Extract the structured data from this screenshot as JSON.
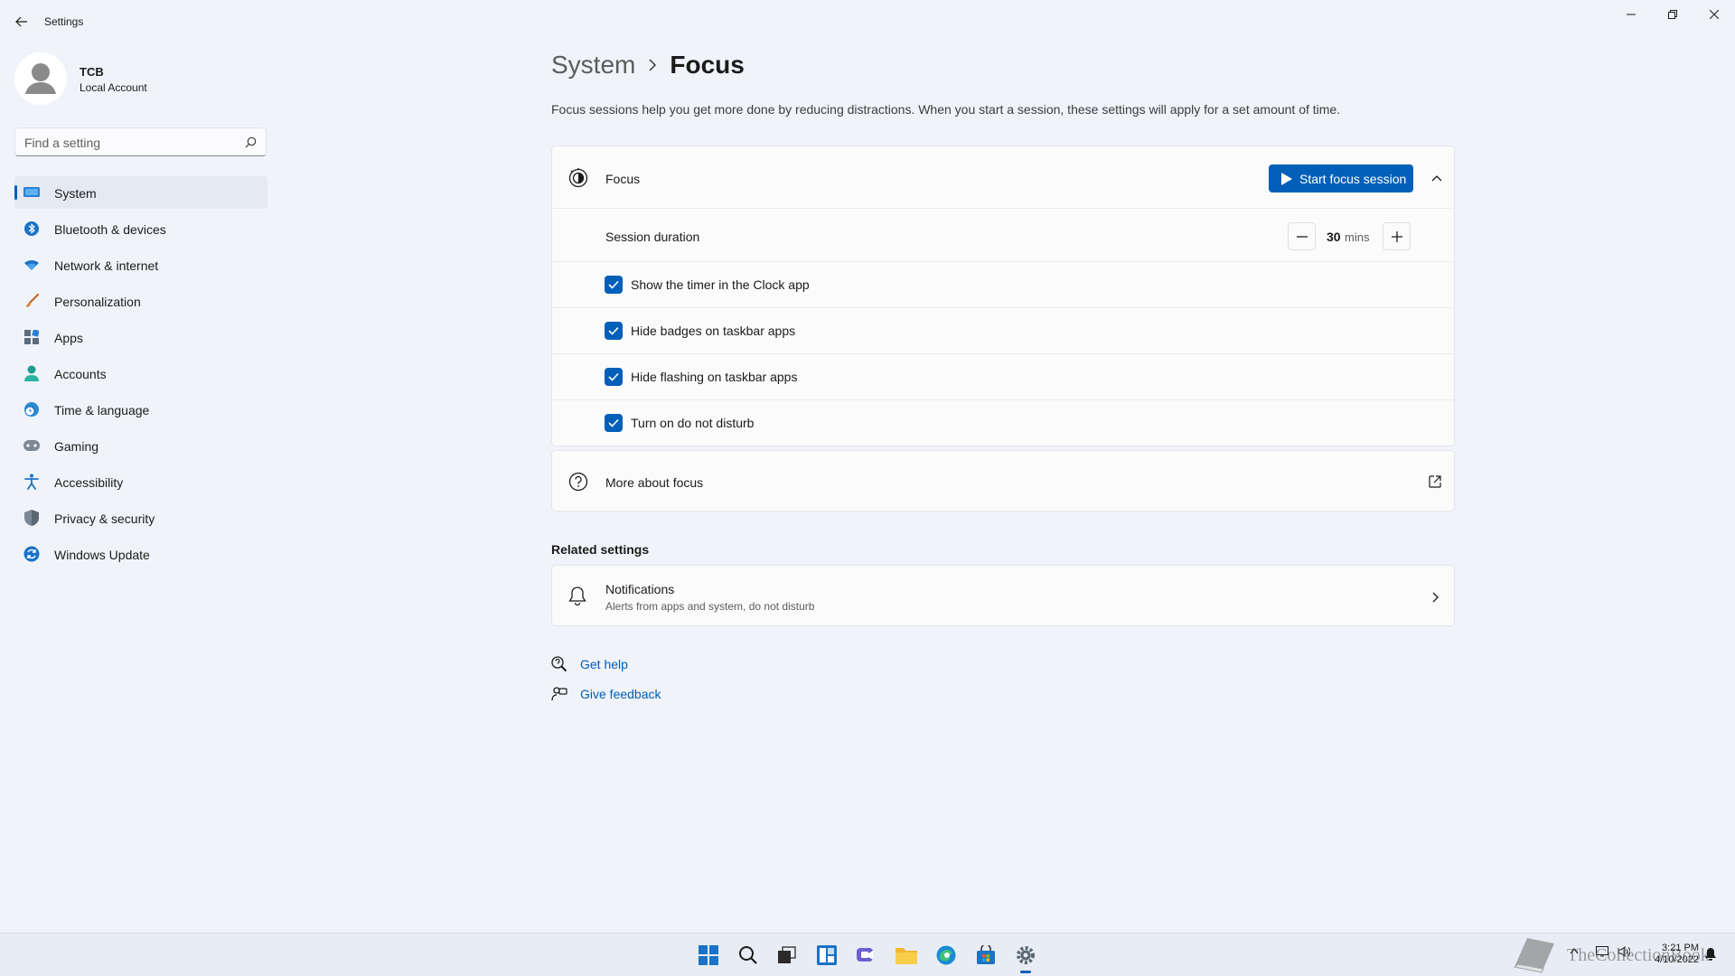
{
  "window": {
    "app_title": "Settings"
  },
  "profile": {
    "name": "TCB",
    "account_type": "Local Account"
  },
  "search": {
    "placeholder": "Find a setting"
  },
  "sidebar": {
    "items": [
      {
        "label": "System",
        "icon": "system-display-icon",
        "selected": true
      },
      {
        "label": "Bluetooth & devices",
        "icon": "bluetooth-icon"
      },
      {
        "label": "Network & internet",
        "icon": "wifi-icon"
      },
      {
        "label": "Personalization",
        "icon": "brush-icon"
      },
      {
        "label": "Apps",
        "icon": "apps-icon"
      },
      {
        "label": "Accounts",
        "icon": "person-icon"
      },
      {
        "label": "Time & language",
        "icon": "globe-clock-icon"
      },
      {
        "label": "Gaming",
        "icon": "gamepad-icon"
      },
      {
        "label": "Accessibility",
        "icon": "accessibility-icon"
      },
      {
        "label": "Privacy & security",
        "icon": "shield-icon"
      },
      {
        "label": "Windows Update",
        "icon": "update-icon"
      }
    ]
  },
  "breadcrumb": {
    "parent": "System",
    "current": "Focus"
  },
  "description": "Focus sessions help you get more done by reducing distractions. When you start a session, these settings will apply for a set amount of time.",
  "focus_card": {
    "title": "Focus",
    "start_button": "Start focus session",
    "session_duration_label": "Session duration",
    "duration_value": "30",
    "duration_unit": "mins",
    "options": [
      {
        "label": "Show the timer in the Clock app",
        "checked": true
      },
      {
        "label": "Hide badges on taskbar apps",
        "checked": true
      },
      {
        "label": "Hide flashing on taskbar apps",
        "checked": true
      },
      {
        "label": "Turn on do not disturb",
        "checked": true
      }
    ]
  },
  "more_about": {
    "label": "More about focus"
  },
  "related": {
    "title": "Related settings",
    "notifications_title": "Notifications",
    "notifications_sub": "Alerts from apps and system, do not disturb"
  },
  "help": {
    "get_help": "Get help",
    "give_feedback": "Give feedback"
  },
  "taskbar": {
    "time": "3:21 PM",
    "date": "4/10/2022",
    "watermark": "TheCollectionBook",
    "icons": [
      "start-icon",
      "search-icon",
      "task-view-icon",
      "widgets-icon",
      "chat-icon",
      "file-explorer-icon",
      "edge-icon",
      "store-icon",
      "settings-icon"
    ]
  },
  "colors": {
    "accent": "#005fb8",
    "background": "#f0f3f9",
    "card": "#fbfbfc"
  }
}
